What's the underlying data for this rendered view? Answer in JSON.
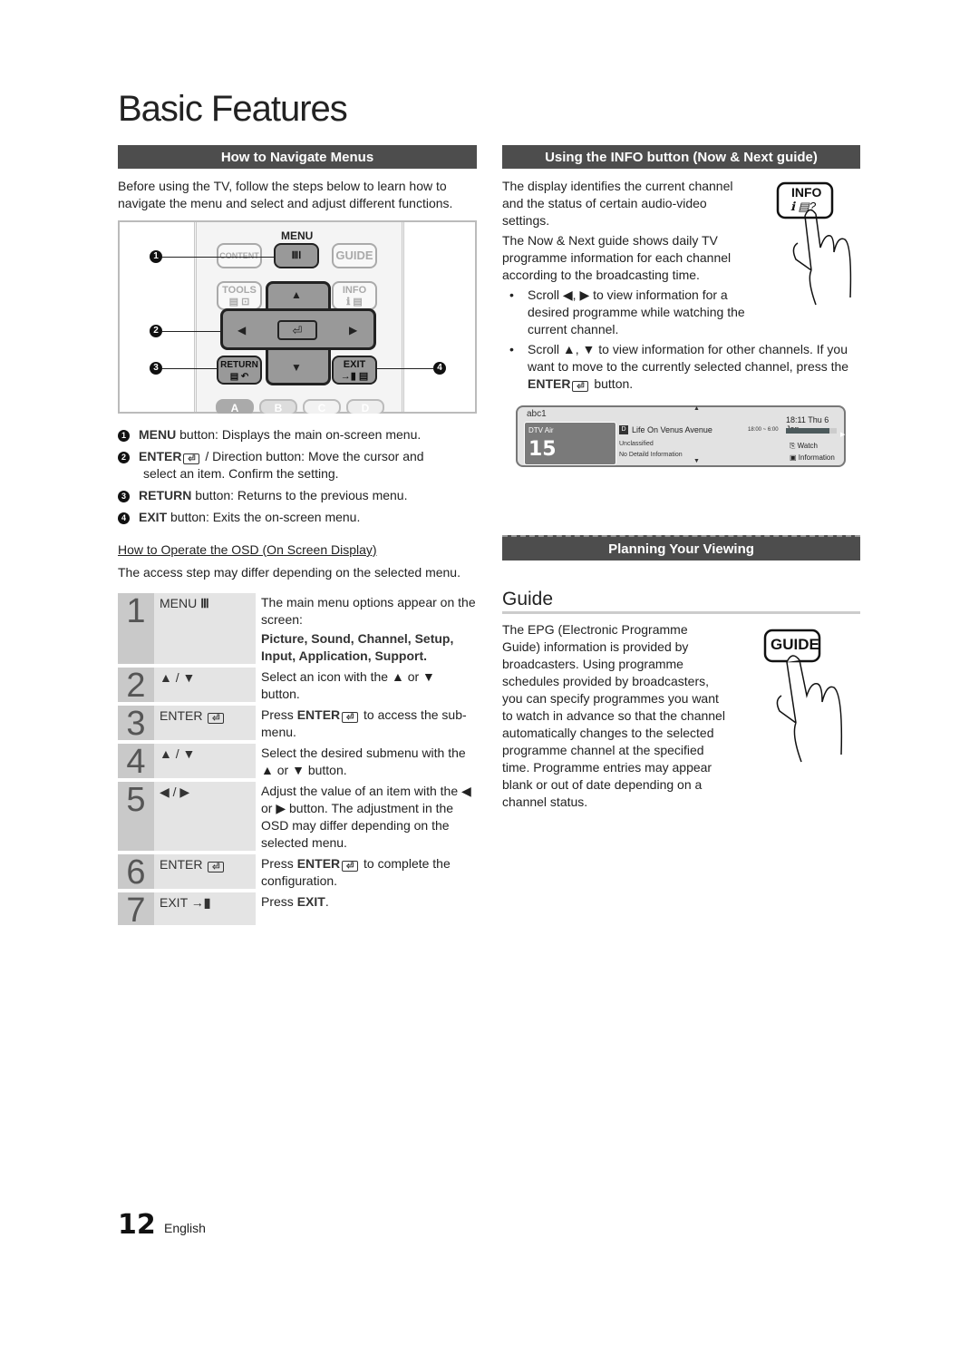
{
  "page": {
    "title": "Basic Features",
    "page_number": "12",
    "language": "English"
  },
  "navigate": {
    "heading": "How to Navigate Menus",
    "intro": "Before using the TV, follow the steps below to learn how to navigate the menu and select and adjust different functions.",
    "remote": {
      "menu_label": "MENU",
      "content_label": "CONTENT",
      "guide_label": "GUIDE",
      "tools_label": "TOOLS",
      "info_label": "INFO",
      "return_label": "RETURN",
      "exit_label": "EXIT",
      "color_buttons": [
        "A",
        "B",
        "C",
        "D"
      ],
      "callouts": [
        "1",
        "2",
        "3",
        "4"
      ]
    },
    "legend": [
      {
        "num": "1",
        "key": "MENU",
        "text": " button: Displays the main on-screen menu."
      },
      {
        "num": "2",
        "key": "ENTER",
        "text": " / Direction button: Move the cursor and",
        "cont": "select an item. Confirm the setting."
      },
      {
        "num": "3",
        "key": "RETURN",
        "text": " button: Returns to the previous menu."
      },
      {
        "num": "4",
        "key": "EXIT",
        "text": " button: Exits the on-screen menu."
      }
    ]
  },
  "osd": {
    "heading": "How to Operate the OSD (On Screen Display)",
    "note": "The access step may differ depending on the selected menu.",
    "steps": [
      {
        "num": "1",
        "key": "MENU",
        "desc": "The main menu options appear on the screen:",
        "desc_bold": "Picture, Sound, Channel, Setup, Input, Application, Support."
      },
      {
        "num": "2",
        "key": "▲ / ▼",
        "desc": "Select an icon with the ▲ or ▼ button."
      },
      {
        "num": "3",
        "key": "ENTER",
        "desc_pre": "Press ",
        "desc_key": "ENTER",
        "desc_post": " to access the sub-menu."
      },
      {
        "num": "4",
        "key": "▲ / ▼",
        "desc": "Select the desired submenu with the ▲ or ▼ button."
      },
      {
        "num": "5",
        "key": "◀ / ▶",
        "desc": "Adjust the value of an item with the ◀ or ▶ button. The adjustment in the OSD may differ depending on the selected menu."
      },
      {
        "num": "6",
        "key": "ENTER",
        "desc_pre": "Press ",
        "desc_key": "ENTER",
        "desc_post": " to complete the configuration."
      },
      {
        "num": "7",
        "key": "EXIT",
        "desc_pre": "Press ",
        "desc_key": "EXIT",
        "desc_post": "."
      }
    ]
  },
  "info": {
    "heading": "Using the INFO button (Now & Next guide)",
    "p1": "The display identifies the current channel and the status of certain audio-video settings.",
    "p2": "The Now & Next guide shows daily TV programme information for each channel according to the broadcasting time.",
    "bullet1": "Scroll ◀, ▶ to view information for a desired programme while watching the current channel.",
    "bullet2_pre": "Scroll ▲, ▼ to view information for other channels. If you want to move to the currently selected channel, press the ",
    "bullet2_key": "ENTER",
    "bullet2_post": " button.",
    "hand_button": "INFO",
    "screen": {
      "channel_name": "abc1",
      "source": "DTV Air",
      "channel_number": "15",
      "programme_badge": "D",
      "programme": "Life On Venus Avenue",
      "rating": "Unclassified",
      "detail": "No Detaild Information",
      "clock": "18:11 Thu 6 Jan",
      "time_range": "18:00 ~ 6:00",
      "progress": 0.85,
      "watch_label": "Watch",
      "information_label": "Information"
    }
  },
  "planning": {
    "heading": "Planning Your Viewing",
    "guide_title": "Guide",
    "guide_text": "The EPG (Electronic Programme Guide) information is provided by broadcasters. Using programme schedules provided by broadcasters, you can specify programmes you want to watch in advance so that the channel automatically changes to the selected programme channel at the specified time. Programme entries may appear blank or out of date depending on a channel status.",
    "hand_button": "GUIDE"
  }
}
